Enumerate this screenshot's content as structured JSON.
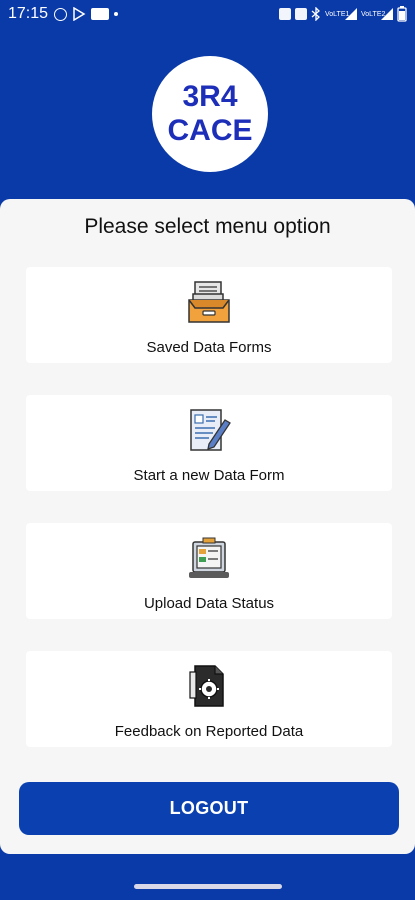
{
  "status_bar": {
    "time": "17:15",
    "icons_left": [
      "whatsapp-icon",
      "play-store-icon",
      "media-icon",
      "dot-icon"
    ],
    "icons_right": [
      "alarm-icon",
      "vibrate-icon",
      "bluetooth-icon",
      "signal-lte1-icon",
      "signal-lte2-icon",
      "battery-icon"
    ]
  },
  "logo": {
    "line1": "3R4",
    "line2": "CACE"
  },
  "main": {
    "title": "Please select menu option",
    "items": [
      {
        "label": "Saved Data Forms",
        "icon": "archive-box-icon"
      },
      {
        "label": "Start a new Data Form",
        "icon": "form-pencil-icon"
      },
      {
        "label": "Upload Data Status",
        "icon": "upload-status-icon"
      },
      {
        "label": "Feedback on Reported Data",
        "icon": "feedback-document-icon"
      }
    ],
    "logout_label": "LOGOUT"
  },
  "colors": {
    "brand_blue": "#0a3aa8",
    "button_blue": "#0b40b0",
    "logo_text": "#1d2fb8"
  }
}
